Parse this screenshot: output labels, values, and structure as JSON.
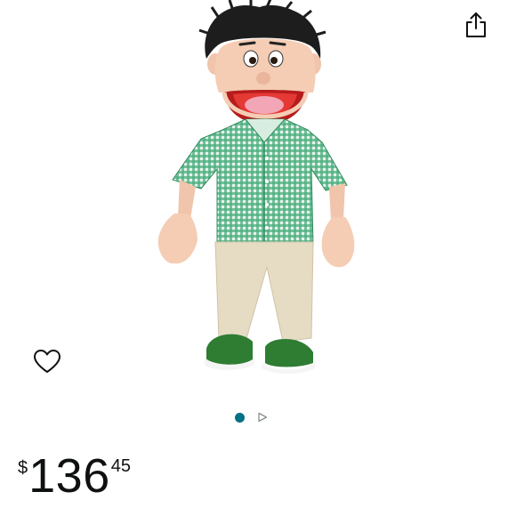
{
  "page": {
    "background": "#ffffff"
  },
  "toolbar": {
    "share_icon": "share-icon"
  },
  "product": {
    "image_subject": "hand-puppet-boy-green-gingham-shirt",
    "wishlist_icon": "heart-outline-icon"
  },
  "carousel": {
    "image_count": 1,
    "active_index": 0,
    "active_color": "#007185",
    "has_video": true,
    "video_icon": "play-outline-icon"
  },
  "price": {
    "currency_symbol": "$",
    "whole": "136",
    "fraction": "45"
  }
}
